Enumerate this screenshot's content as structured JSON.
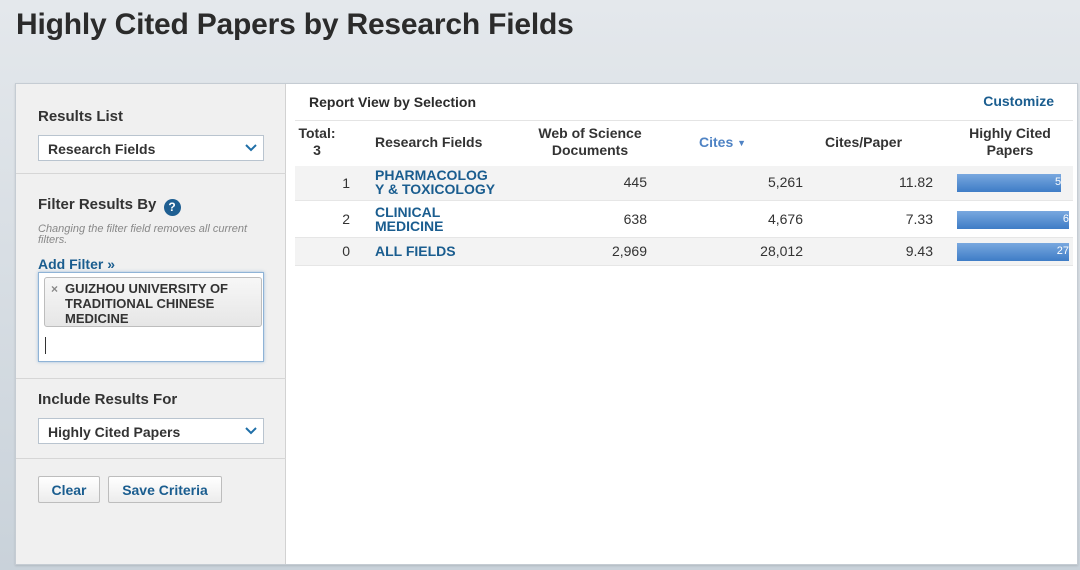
{
  "page_title": "Highly Cited Papers by Research Fields",
  "sidebar": {
    "results_list": {
      "title": "Results List",
      "selected": "Research Fields"
    },
    "filter": {
      "title": "Filter Results By",
      "note": "Changing the filter field removes all current filters.",
      "add_filter": "Add Filter »",
      "chip_text": "GUIZHOU UNIVERSITY OF TRADITIONAL CHINESE MEDICINE",
      "chip_remove": "×"
    },
    "include": {
      "title": "Include Results For",
      "selected": "Highly Cited Papers"
    },
    "buttons": {
      "clear": "Clear",
      "save": "Save Criteria"
    }
  },
  "main": {
    "report_title": "Report View by Selection",
    "customize": "Customize",
    "headers": {
      "total": "Total:",
      "total_count": "3",
      "field": "Research Fields",
      "docs_line1": "Web of Science",
      "docs_line2": "Documents",
      "cites": "Cites",
      "cites_paper": "Cites/Paper",
      "hcp_line1": "Highly Cited",
      "hcp_line2": "Papers"
    },
    "rows": [
      {
        "rank": "1",
        "field_line1": "PHARMACOLOG",
        "field_line2": "Y & TOXICOLOGY",
        "docs": "445",
        "cites": "5,261",
        "cites_per_paper": "11.82",
        "hcp_label": "5",
        "hcp_fill": 0.93
      },
      {
        "rank": "2",
        "field_line1": "CLINICAL",
        "field_line2": "MEDICINE",
        "docs": "638",
        "cites": "4,676",
        "cites_per_paper": "7.33",
        "hcp_label": "6",
        "hcp_fill": 1.0
      },
      {
        "rank": "0",
        "field_line1": "ALL FIELDS",
        "field_line2": "",
        "docs": "2,969",
        "cites": "28,012",
        "cites_per_paper": "9.43",
        "hcp_label": "27",
        "hcp_fill": 1.0
      }
    ]
  },
  "colors": {
    "link": "#1a5d8f",
    "bar": "#4a86cc",
    "sort_link": "#4f83c4"
  },
  "icons": {
    "dropdown": "chevron-down-icon",
    "help": "help-icon",
    "sort": "caret-down-icon",
    "remove": "close-icon"
  }
}
